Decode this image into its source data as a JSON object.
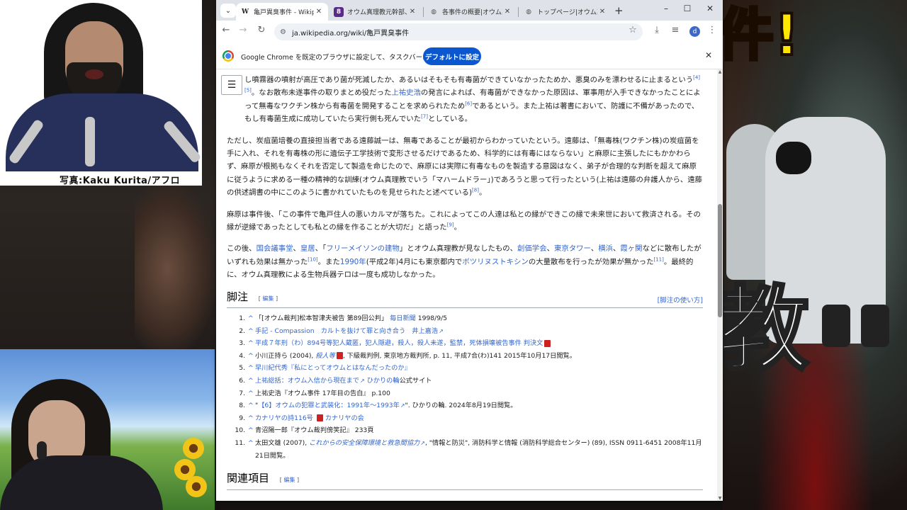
{
  "overlay": {
    "photo_caption": "写真:Kaku Kurita/アフロ",
    "banner_top": "件!",
    "banner_mid": "教"
  },
  "browser": {
    "tabs": [
      {
        "title": "亀戸異臭事件 - Wikiped",
        "favicon": "W",
        "active": true
      },
      {
        "title": "オウム真理教元幹部、真",
        "favicon": "8",
        "active": false
      },
      {
        "title": "各事件の概要|オウム真",
        "favicon": "globe",
        "active": false
      },
      {
        "title": "トップページ|オウム真理教",
        "favicon": "globe",
        "active": false
      }
    ],
    "new_tab": "+",
    "window_controls": [
      "–",
      "☐",
      "✕"
    ],
    "url": "ja.wikipedia.org/wiki/亀戸異臭事件",
    "avatar_letter": "d",
    "infobar": {
      "text": "Google Chrome を既定のブラウザに設定して、タスクバーに固定する",
      "button": "デフォルトに設定"
    }
  },
  "article": {
    "p1": {
      "a": "し噴霧器の噴射が高圧であり菌が死滅したか、あるいはそもそも有毒菌ができていなかったためか、悪臭のみを漂わせるに止まるという",
      "ref_a": "[4][5]",
      "b": "。なお散布未遂事件の取りまとめ役だった",
      "link_1": "上祐史浩",
      "c": "の発言によれば、有毒菌ができなかった原因は、軍事用が入手できなかったことによって無毒なワクチン株から有毒菌を開発することを求められたため",
      "ref_b": "[6]",
      "d": "であるという。また上祐は著書において、防護に不備があったので、もし有毒菌生成に成功していたら実行側も死んでいた",
      "ref_c": "[7]",
      "e": "としている。"
    },
    "p2": {
      "text": "ただし、炭疽菌培養の直接担当者である遠藤誠一は、無毒であることが最初からわかっていたという。遠藤は、「無毒株(ワクチン株)の炭疽菌を手に入れ、それを有毒株の形に遺伝子工学技術で変形させるだけであるため、科学的には有毒にはならない」と麻原に主張したにもかかわらず、麻原が根拠もなくそれを否定して製造を命じたので、麻原には実際に有毒なものを製造する意図はなく、弟子が合理的な判断を超えて麻原に従うように求める一種の精神的な訓練(オウム真理教でいう「マハームドラー」)であろうと思って行ったという(上祐は遠藤の弁護人から、遠藤の供述調書の中にこのように書かれていたものを見せられたと述べている)",
      "ref": "[8]",
      "end": "。"
    },
    "p3": {
      "text": "麻原は事件後、「この事件で亀戸住人の悪いカルマが落ちた。これによってこの人達は私との縁ができこの縁で未来世において救済される。その縁が逆縁であったとしても私との縁を作ることが大切だ」と語った",
      "ref": "[9]",
      "end": "。"
    },
    "p4": {
      "a": "この後、",
      "l1": "国会議事堂",
      "s1": "、",
      "l2": "皇居",
      "s2": "、「",
      "l3": "フリーメイソンの建物",
      "b": "」とオウム真理教が見なしたもの、",
      "l4": "創価学会",
      "s3": "、",
      "l5": "東京タワー",
      "s4": "、",
      "l6": "横浜",
      "s5": "、",
      "l7": "霞ヶ関",
      "c": "などに散布したがいずれも効果は無かった",
      "ref_a": "[10]",
      "d": "。また",
      "l8": "1990年",
      "e": "(平成2年)4月にも東京都内で",
      "l9": "ボツリヌストキシン",
      "f": "の大量散布を行ったが効果が無かった",
      "ref_b": "[11]",
      "g": "。最終的に、オウム真理教による生物兵器テロは一度も成功しなかった。"
    }
  },
  "footnotes": {
    "heading": "脚注",
    "edit": "編集",
    "help": "[脚注の使い方]",
    "items": [
      {
        "num": "1.",
        "plain": "「[オウム裁判]松本智津夫被告 第89回公判」",
        "link": "毎日新聞",
        "tail": " 1998/9/5"
      },
      {
        "num": "2.",
        "link": "手記 - Compassion　カルトを抜けて罪と向き合う　井上嘉浩",
        "tail": ""
      },
      {
        "num": "3.",
        "link": "平成７年刑（わ）894号等犯人蔵匿，犯人隠避，殺人，殺人未遂，監禁，死体損壊被告事件 判決文",
        "tail": ""
      },
      {
        "num": "4.",
        "plain": "小川正持ら (2004), ",
        "link": "殺人等",
        "tail": ", 下級裁判例, 東京地方裁判所, p. 11, 平成7合(わ)141 2015年10月17日閲覧。"
      },
      {
        "num": "5.",
        "link": "早川紀代秀『私にとってオウムとはなんだったのか』",
        "tail": ""
      },
      {
        "num": "6.",
        "link": "上祐総括：オウム入信から現在まで",
        "link2": "ひかりの輪",
        "tail": "公式サイト"
      },
      {
        "num": "7.",
        "plain": "上祐史浩『オウム事件 17年目の告白』 p.100",
        "tail": ""
      },
      {
        "num": "8.",
        "plain": "\"",
        "link": "【6】オウムの犯罪と武装化：1991年〜1993年",
        "tail": "\". ひかりの輪. 2024年8月19日閲覧。"
      },
      {
        "num": "9.",
        "link": "カナリヤの詩116号",
        "link2": "カナリヤの会",
        "tail": ""
      },
      {
        "num": "10.",
        "plain": "青沼陽一郎『オウム裁判傍笑記』 233頁",
        "tail": ""
      },
      {
        "num": "11.",
        "plain": "太田文雄 (2007), ",
        "link": "これからの安全保障環境と救急間協力",
        "tail": ", \"情報と防災\", 消防科学と情報 (消防科学総合センター) (89), ISSN 0911-6451 2008年11月21日閲覧。"
      }
    ]
  },
  "related": {
    "heading": "関連項目",
    "edit": "編集"
  }
}
